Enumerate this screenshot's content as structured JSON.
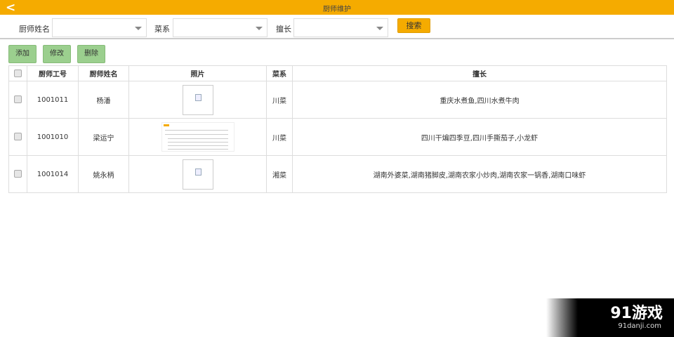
{
  "header": {
    "title": "厨师维护",
    "back_icon": "chevron-left-icon",
    "color": "#f5ab00"
  },
  "filters": {
    "name_label": "厨师姓名",
    "name_value": "",
    "cuisine_label": "菜系",
    "cuisine_value": "",
    "specialty_label": "擅长",
    "specialty_value": "",
    "search_label": "搜索"
  },
  "toolbar": {
    "add": "添加",
    "edit": "修改",
    "delete": "删除",
    "button_color": "#9bcf8e"
  },
  "table": {
    "columns": [
      "厨师工号",
      "厨师姓名",
      "照片",
      "菜系",
      "擅长"
    ],
    "rows": [
      {
        "id": "1001011",
        "name": "杨潘",
        "photo": "broken-image",
        "cuisine": "川菜",
        "specialty": "重庆水煮鱼,四川水煮牛肉"
      },
      {
        "id": "1001010",
        "name": "梁运宁",
        "photo": "screenshot-thumbnail",
        "cuisine": "川菜",
        "specialty": "四川干煸四季豆,四川手撕茄子,小龙虾"
      },
      {
        "id": "1001014",
        "name": "姚永柄",
        "photo": "broken-image",
        "cuisine": "湘菜",
        "specialty": "湖南外婆菜,湖南猪脚皮,湖南农家小炒肉,湖南农家一锅香,湖南口味虾"
      }
    ]
  },
  "watermark": {
    "logo": "91游戏",
    "site": "91danji.com"
  }
}
